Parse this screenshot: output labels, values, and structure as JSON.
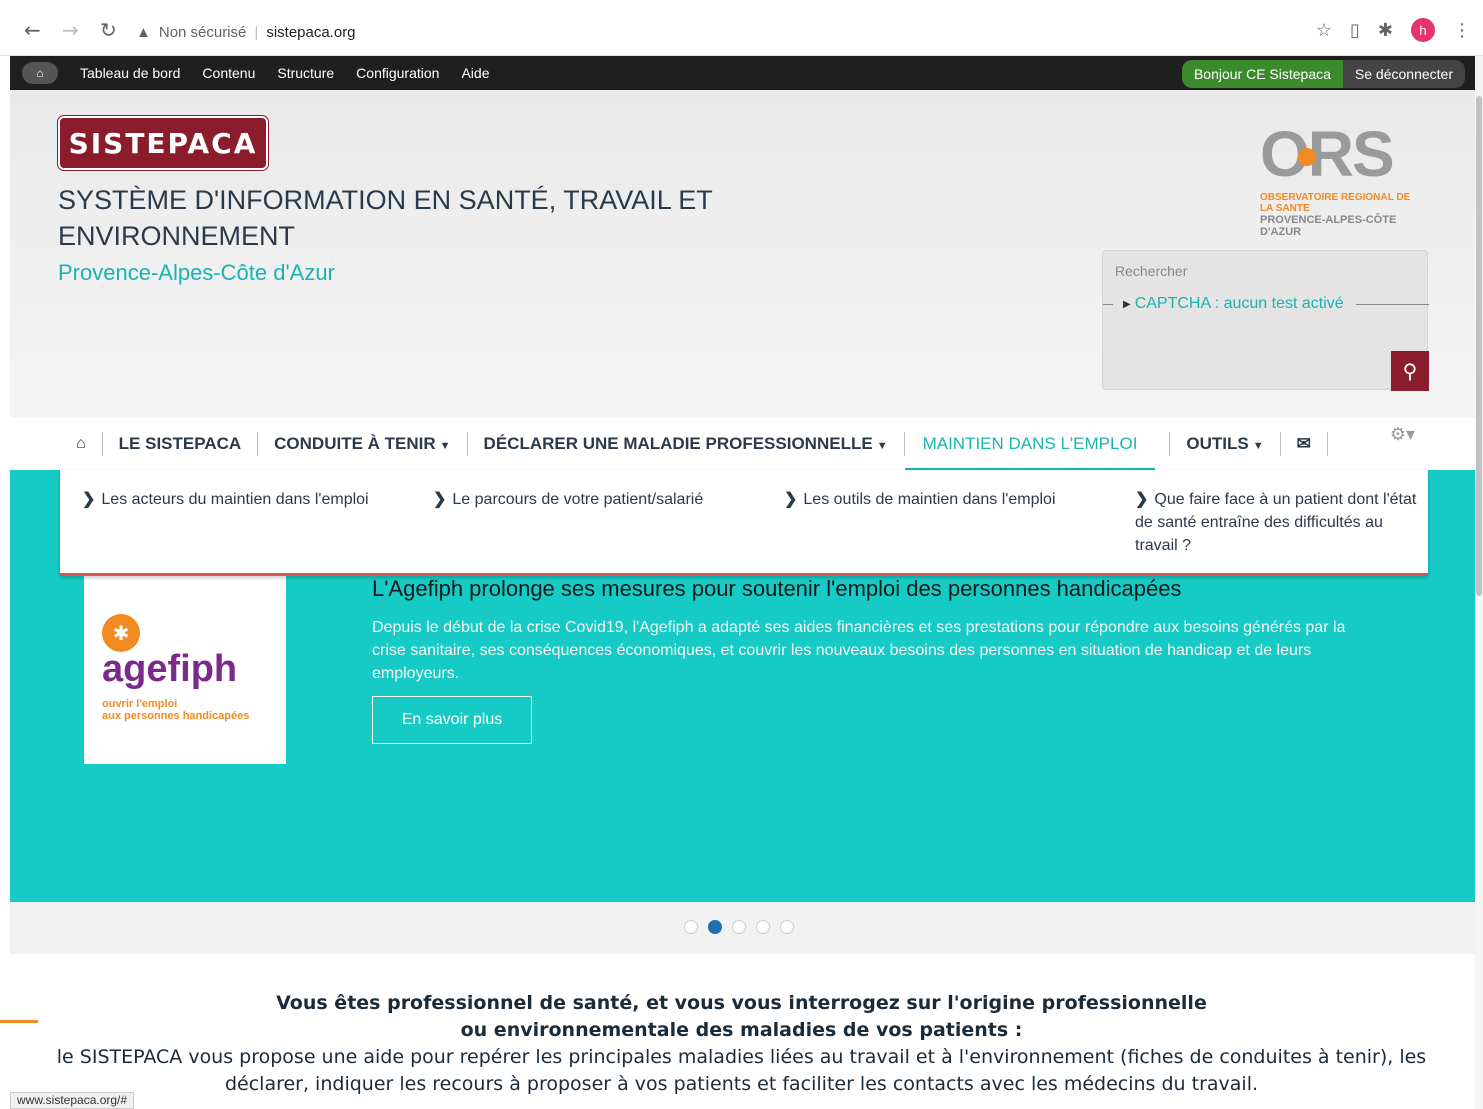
{
  "browser": {
    "security": "Non sécurisé",
    "url": "sistepaca.org",
    "avatar_letter": "h"
  },
  "admin_bar": {
    "items": [
      "Tableau de bord",
      "Contenu",
      "Structure",
      "Configuration",
      "Aide"
    ],
    "hello": "Bonjour CE Sistepaca",
    "logout": "Se déconnecter"
  },
  "header": {
    "logo": "SISTEPACA",
    "title": "SYSTÈME D'INFORMATION EN SANTÉ, TRAVAIL ET ENVIRONNEMENT",
    "subtitle": "Provence-Alpes-Côte d'Azur",
    "ors": {
      "word": "ORS",
      "line1": "OBSERVATOIRE REGIONAL DE LA SANTE",
      "line2": "PROVENCE-ALPES-CÔTE D'AZUR"
    }
  },
  "search": {
    "label": "Rechercher",
    "captcha": "CAPTCHA : aucun test activé"
  },
  "nav": {
    "items": [
      "LE SISTEPACA",
      "CONDUITE À TENIR",
      "DÉCLARER UNE MALADIE PROFESSIONNELLE",
      "MAINTIEN DANS L'EMPLOI",
      "OUTILS"
    ]
  },
  "dropdown": {
    "items": [
      "Les acteurs du maintien dans l'emploi",
      "Le parcours de votre patient/salarié",
      "Les outils de maintien dans l'emploi",
      "Que faire face à un patient dont l'état de santé entraîne des difficultés au travail ?"
    ]
  },
  "slide": {
    "logo_word": "agefiph",
    "logo_tag_1": "ouvrir l'emploi",
    "logo_tag_2": "aux personnes handicapées",
    "title": "L'Agefiph prolonge ses mesures pour soutenir l'emploi des personnes handicapées",
    "text": "Depuis le début de la crise Covid19, l'Agefiph a adapté ses aides financières et ses prestations pour répondre aux besoins générés par la crise sanitaire, ses conséquences économiques, et couvrir les nouveaux besoins des personnes en situation de handicap et de leurs employeurs.",
    "button": "En savoir plus",
    "active_index": 1
  },
  "intro": {
    "head_1": "Vous êtes professionnel de santé, et vous vous interrogez sur l'origine professionnelle",
    "head_2": "ou environnementale des maladies de vos patients :",
    "body": "le SISTEPACA vous propose une aide pour repérer les principales maladies liées au travail et à l'environnement (fiches de conduites à tenir), les déclarer, indiquer les recours à proposer à vos patients et faciliter les contacts avec les médecins du travail."
  },
  "status": "www.sistepaca.org/#",
  "colors": {
    "brand": "#8b1c2b",
    "accent": "#19b3b0",
    "slide_bg": "#16cbc6",
    "admin_bg": "#1f1f1f"
  }
}
